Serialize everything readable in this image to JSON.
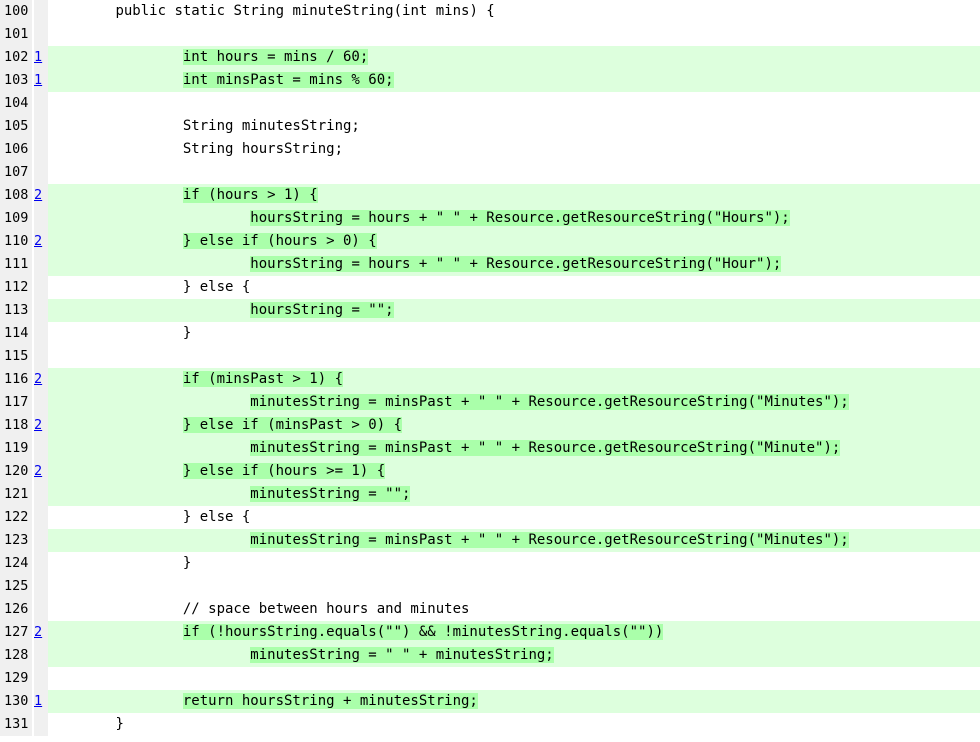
{
  "lines": [
    {
      "num": "100",
      "hits": "",
      "covered": false,
      "indent": "        ",
      "text": "public static String minuteString(int mins) {"
    },
    {
      "num": "101",
      "hits": "",
      "covered": false,
      "indent": "",
      "text": ""
    },
    {
      "num": "102",
      "hits": "1",
      "covered": true,
      "indent": "                ",
      "text": "int hours = mins / 60;"
    },
    {
      "num": "103",
      "hits": "1",
      "covered": true,
      "indent": "                ",
      "text": "int minsPast = mins % 60;"
    },
    {
      "num": "104",
      "hits": "",
      "covered": false,
      "indent": "",
      "text": ""
    },
    {
      "num": "105",
      "hits": "",
      "covered": false,
      "indent": "                ",
      "text": "String minutesString;"
    },
    {
      "num": "106",
      "hits": "",
      "covered": false,
      "indent": "                ",
      "text": "String hoursString;"
    },
    {
      "num": "107",
      "hits": "",
      "covered": false,
      "indent": "",
      "text": ""
    },
    {
      "num": "108",
      "hits": "2",
      "covered": true,
      "indent": "                ",
      "text": "if (hours > 1) {"
    },
    {
      "num": "109",
      "hits": "",
      "covered": true,
      "indent": "                        ",
      "text": "hoursString = hours + \" \" + Resource.getResourceString(\"Hours\");"
    },
    {
      "num": "110",
      "hits": "2",
      "covered": true,
      "indent": "                ",
      "text": "} else if (hours > 0) {"
    },
    {
      "num": "111",
      "hits": "",
      "covered": true,
      "indent": "                        ",
      "text": "hoursString = hours + \" \" + Resource.getResourceString(\"Hour\");"
    },
    {
      "num": "112",
      "hits": "",
      "covered": false,
      "indent": "                ",
      "text": "} else {"
    },
    {
      "num": "113",
      "hits": "",
      "covered": true,
      "indent": "                        ",
      "text": "hoursString = \"\";"
    },
    {
      "num": "114",
      "hits": "",
      "covered": false,
      "indent": "                ",
      "text": "}"
    },
    {
      "num": "115",
      "hits": "",
      "covered": false,
      "indent": "",
      "text": ""
    },
    {
      "num": "116",
      "hits": "2",
      "covered": true,
      "indent": "                ",
      "text": "if (minsPast > 1) {"
    },
    {
      "num": "117",
      "hits": "",
      "covered": true,
      "indent": "                        ",
      "text": "minutesString = minsPast + \" \" + Resource.getResourceString(\"Minutes\");"
    },
    {
      "num": "118",
      "hits": "2",
      "covered": true,
      "indent": "                ",
      "text": "} else if (minsPast > 0) {"
    },
    {
      "num": "119",
      "hits": "",
      "covered": true,
      "indent": "                        ",
      "text": "minutesString = minsPast + \" \" + Resource.getResourceString(\"Minute\");"
    },
    {
      "num": "120",
      "hits": "2",
      "covered": true,
      "indent": "                ",
      "text": "} else if (hours >= 1) {"
    },
    {
      "num": "121",
      "hits": "",
      "covered": true,
      "indent": "                        ",
      "text": "minutesString = \"\";"
    },
    {
      "num": "122",
      "hits": "",
      "covered": false,
      "indent": "                ",
      "text": "} else {"
    },
    {
      "num": "123",
      "hits": "",
      "covered": true,
      "indent": "                        ",
      "text": "minutesString = minsPast + \" \" + Resource.getResourceString(\"Minutes\");"
    },
    {
      "num": "124",
      "hits": "",
      "covered": false,
      "indent": "                ",
      "text": "}"
    },
    {
      "num": "125",
      "hits": "",
      "covered": false,
      "indent": "",
      "text": ""
    },
    {
      "num": "126",
      "hits": "",
      "covered": false,
      "indent": "                ",
      "text": "// space between hours and minutes"
    },
    {
      "num": "127",
      "hits": "2",
      "covered": true,
      "indent": "                ",
      "text": "if (!hoursString.equals(\"\") && !minutesString.equals(\"\"))"
    },
    {
      "num": "128",
      "hits": "",
      "covered": true,
      "indent": "                        ",
      "text": "minutesString = \" \" + minutesString;"
    },
    {
      "num": "129",
      "hits": "",
      "covered": false,
      "indent": "",
      "text": ""
    },
    {
      "num": "130",
      "hits": "1",
      "covered": true,
      "indent": "                ",
      "text": "return hoursString + minutesString;"
    },
    {
      "num": "131",
      "hits": "",
      "covered": false,
      "indent": "        ",
      "text": "}"
    }
  ],
  "colors": {
    "covered_background": "#ddffdd",
    "covered_statement": "#aaffaa",
    "gutter_background": "#f0f0f0",
    "hit_link": "#0000ee"
  }
}
